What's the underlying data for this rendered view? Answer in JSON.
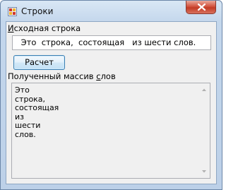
{
  "window": {
    "title": "Строки"
  },
  "labels": {
    "source_prefix": "И",
    "source_rest": "сходная строка",
    "result_prefix": "Полученный массив ",
    "result_u": "с",
    "result_rest": "лов"
  },
  "source_input": {
    "value": " Это  строка,  состоящая   из шести слов."
  },
  "calc_button": {
    "label": "Расчет"
  },
  "result": {
    "text": "Это\nстрока,\nсостоящая\nиз\nшести\nслов."
  },
  "icons": {
    "app": "form-app-icon",
    "close": "close-icon",
    "scroll_up": "scroll-up-arrow-icon",
    "scroll_down": "scroll-down-arrow-icon"
  },
  "colors": {
    "close_button": "#c9432d",
    "title_bar": "#c4d7ec",
    "button_border": "#3c7fb1"
  }
}
